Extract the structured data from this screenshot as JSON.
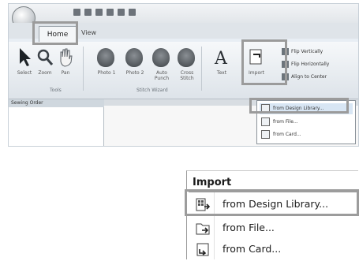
{
  "app": {
    "tabs": [
      {
        "label": "Home"
      },
      {
        "label": "View"
      }
    ],
    "ribbon_buttons": [
      {
        "label": "Select",
        "icon": "arrow-cursor-icon"
      },
      {
        "label": "Zoom",
        "icon": "magnifier-icon"
      },
      {
        "label": "Pan",
        "icon": "hand-icon"
      },
      {
        "label": "Photo 1",
        "icon": "portrait-icon"
      },
      {
        "label": "Photo 2",
        "icon": "portrait-icon"
      },
      {
        "label": "Auto Punch",
        "icon": "portrait-icon"
      },
      {
        "label": "Cross Stitch",
        "icon": "portrait-icon"
      },
      {
        "label": "Text",
        "icon": "text-a-icon"
      },
      {
        "label": "Import",
        "icon": "import-icon"
      }
    ],
    "groups": [
      "Tools",
      "Stitch Wizard"
    ],
    "right_buttons": [
      {
        "label": "Flip Vertically"
      },
      {
        "label": "Flip Horizontally"
      },
      {
        "label": "Align to Center"
      }
    ],
    "side_panel_title": "Sewing Order",
    "small_menu": [
      "from Design Library...",
      "from File...",
      "from Card..."
    ]
  },
  "import_menu": {
    "title": "Import",
    "items": [
      {
        "label": "from Design Library...",
        "icon": "design-library-icon"
      },
      {
        "label": "from File...",
        "icon": "folder-file-icon"
      },
      {
        "label": "from Card...",
        "icon": "card-icon"
      }
    ]
  }
}
